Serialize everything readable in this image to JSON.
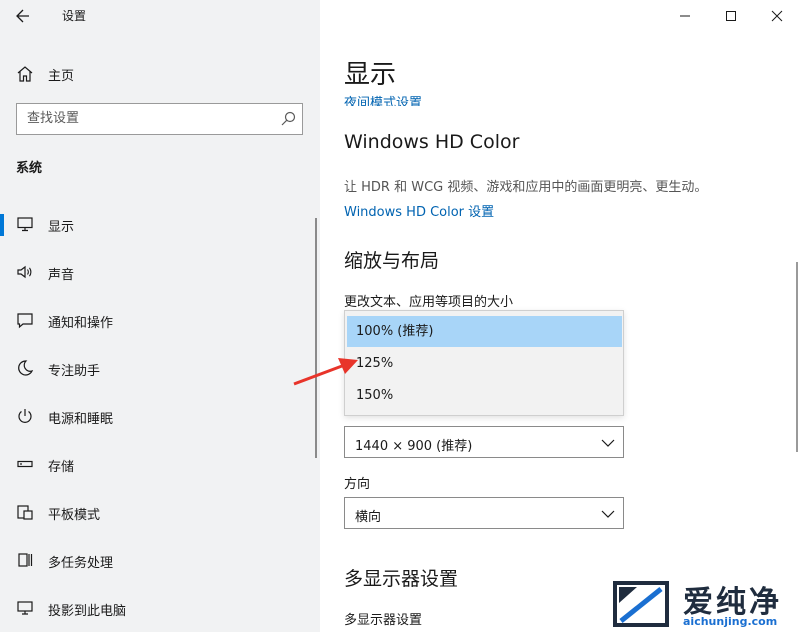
{
  "window": {
    "title": "设置",
    "controls": [
      "minimize-icon",
      "maximize-icon",
      "close-icon"
    ]
  },
  "sidebar": {
    "home_label": "主页",
    "search_placeholder": "查找设置",
    "section_title": "系统",
    "items": [
      {
        "label": "显示",
        "icon": "monitor-icon",
        "active": true
      },
      {
        "label": "声音",
        "icon": "speaker-icon"
      },
      {
        "label": "通知和操作",
        "icon": "notification-icon"
      },
      {
        "label": "专注助手",
        "icon": "moon-icon"
      },
      {
        "label": "电源和睡眠",
        "icon": "power-icon"
      },
      {
        "label": "存储",
        "icon": "storage-icon"
      },
      {
        "label": "平板模式",
        "icon": "tablet-icon"
      },
      {
        "label": "多任务处理",
        "icon": "multitask-icon"
      },
      {
        "label": "投影到此电脑",
        "icon": "project-icon"
      }
    ]
  },
  "main": {
    "title": "显示",
    "clipped_link": "夜间模式设置",
    "hdr": {
      "title": "Windows HD Color",
      "description": "让 HDR 和 WCG 视频、游戏和应用中的画面更明亮、更生动。",
      "link": "Windows HD Color 设置"
    },
    "scale": {
      "title": "缩放与布局",
      "label": "更改文本、应用等项目的大小",
      "options": [
        "100% (推荐)",
        "125%",
        "150%"
      ],
      "selected_index": 0
    },
    "resolution": {
      "value": "1440 × 900 (推荐)"
    },
    "orientation": {
      "label": "方向",
      "value": "横向"
    },
    "multi_display": {
      "title": "多显示器设置",
      "subtitle": "多显示器设置"
    }
  },
  "colors": {
    "accent": "#0078d7",
    "link": "#0063b1",
    "sidebar_bg": "#f1f2f3",
    "selected_option": "#a8d5f8",
    "annotation": "#e8342a"
  },
  "watermark": {
    "text": "爱纯净",
    "url": "aichunjing.com"
  }
}
